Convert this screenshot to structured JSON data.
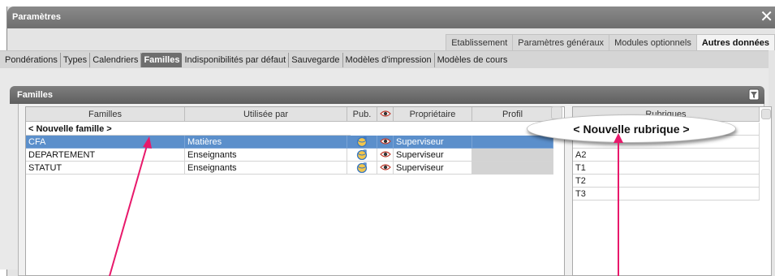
{
  "window": {
    "title": "Paramètres",
    "close_glyph": "✕"
  },
  "tabs_level1": [
    {
      "label": "Etablissement",
      "active": false
    },
    {
      "label": "Paramètres généraux",
      "active": false
    },
    {
      "label": "Modules optionnels",
      "active": false
    },
    {
      "label": "Autres données",
      "active": true
    }
  ],
  "tabs_level2": [
    {
      "label": "Pondérations",
      "active": false
    },
    {
      "label": "Types",
      "active": false
    },
    {
      "label": "Calendriers",
      "active": false
    },
    {
      "label": "Familles",
      "active": true
    },
    {
      "label": "Indisponibilités par défaut",
      "active": false
    },
    {
      "label": "Sauvegarde",
      "active": false
    },
    {
      "label": "Modèles d'impression",
      "active": false
    },
    {
      "label": "Modèles de cours",
      "active": false
    }
  ],
  "section": {
    "title": "Familles",
    "icon": "filter-icon"
  },
  "families_table": {
    "headers": {
      "familles": "Familles",
      "utilisee_par": "Utilisée par",
      "pub": "Pub.",
      "proprietaire": "Propriétaire",
      "profil": "Profil"
    },
    "new_row": "< Nouvelle famille >",
    "rows": [
      {
        "famille": "CFA",
        "utilisee_par": "Matières",
        "proprietaire": "Superviseur",
        "selected": true
      },
      {
        "famille": "DEPARTEMENT",
        "utilisee_par": "Enseignants",
        "proprietaire": "Superviseur",
        "selected": false
      },
      {
        "famille": "STATUT",
        "utilisee_par": "Enseignants",
        "proprietaire": "Superviseur",
        "selected": false
      }
    ]
  },
  "rubriques_list": {
    "header": "Rubriques",
    "items": [
      "A2",
      "T1",
      "T2",
      "T3"
    ]
  },
  "callout": {
    "text": "< Nouvelle rubrique >"
  },
  "colors": {
    "selection": "#5b8fcb",
    "arrow": "#e8196b",
    "titlebar": "#7a7a7a"
  }
}
